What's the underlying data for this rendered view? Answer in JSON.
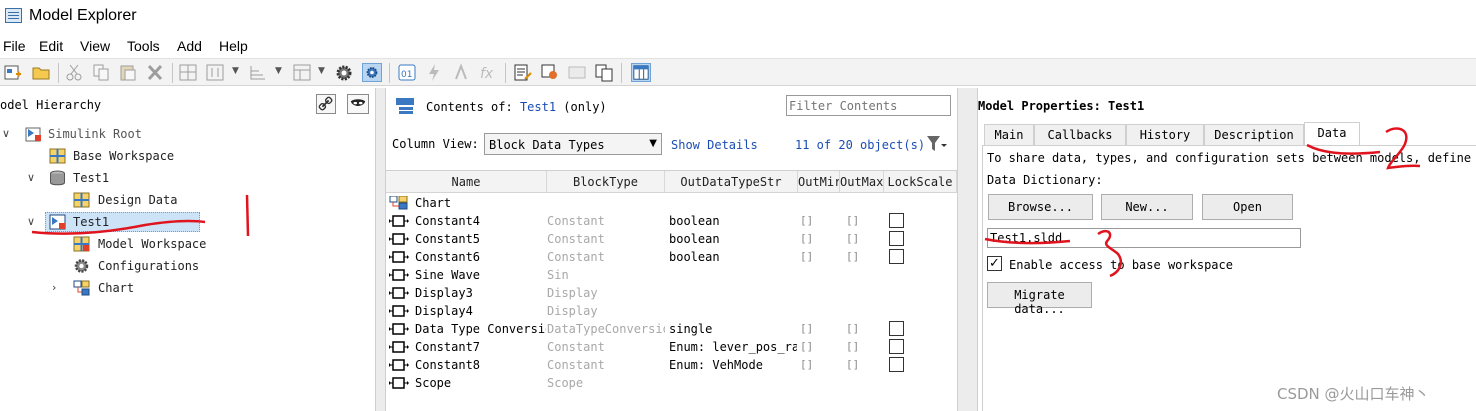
{
  "window": {
    "title": "Model Explorer"
  },
  "menu": [
    "File",
    "Edit",
    "View",
    "Tools",
    "Add",
    "Help"
  ],
  "hierarchy": {
    "title": "Model Hierarchy",
    "display_title": "odel Hierarchy",
    "nodes": [
      {
        "label": "Simulink Root",
        "level": 0,
        "expanded": true,
        "icon": "simulink-root-icon"
      },
      {
        "label": "Base Workspace",
        "level": 1,
        "icon": "workspace-icon"
      },
      {
        "label": "Test1",
        "level": 1,
        "expanded": true,
        "icon": "data-dictionary-icon"
      },
      {
        "label": "Design Data",
        "level": 2,
        "icon": "workspace-icon"
      },
      {
        "label": "Test1",
        "level": 1,
        "expanded": true,
        "icon": "model-icon",
        "selected": true
      },
      {
        "label": "Model Workspace",
        "level": 2,
        "icon": "model-workspace-icon"
      },
      {
        "label": "Configurations",
        "level": 2,
        "icon": "gear-icon"
      },
      {
        "label": "Chart",
        "level": 2,
        "expanded": false,
        "icon": "chart-icon"
      }
    ]
  },
  "contents": {
    "title_prefix": "Contents of:",
    "model_link": "Test1",
    "suffix": "(only)",
    "filter_placeholder": "Filter Contents",
    "column_view_label": "Column View:",
    "column_view_value": "Block Data Types",
    "show_details": "Show Details",
    "count": "11 of 20 object(s)",
    "columns": [
      "Name",
      "BlockType",
      "OutDataTypeStr",
      "OutMin",
      "OutMax",
      "LockScale"
    ],
    "columns_visible": [
      "Name",
      "BlockType",
      "OutDataTypeStr",
      "OutMir",
      "OutMax",
      "LockScale"
    ],
    "rows": [
      {
        "name": "Chart",
        "type": "",
        "dtype": "",
        "outmin": false,
        "outmax": false,
        "lock": false,
        "icon": "chart-icon"
      },
      {
        "name": "Constant4",
        "type": "Constant",
        "dtype": "boolean",
        "outmin": true,
        "outmax": true,
        "lock": true
      },
      {
        "name": "Constant5",
        "type": "Constant",
        "dtype": "boolean",
        "outmin": true,
        "outmax": true,
        "lock": true
      },
      {
        "name": "Constant6",
        "type": "Constant",
        "dtype": "boolean",
        "outmin": true,
        "outmax": true,
        "lock": true
      },
      {
        "name": "Sine Wave",
        "type": "Sin",
        "dtype": "",
        "outmin": false,
        "outmax": false,
        "lock": false
      },
      {
        "name": "Display3",
        "type": "Display",
        "dtype": "",
        "outmin": false,
        "outmax": false,
        "lock": false
      },
      {
        "name": "Display4",
        "type": "Display",
        "dtype": "",
        "outmin": false,
        "outmax": false,
        "lock": false
      },
      {
        "name": "Data Type Conversion",
        "type": "DataTypeConversion",
        "dtype": "single",
        "outmin": true,
        "outmax": true,
        "lock": true
      },
      {
        "name": "Constant7",
        "type": "Constant",
        "dtype": "Enum: lever_pos_raw",
        "outmin": true,
        "outmax": true,
        "lock": true
      },
      {
        "name": "Constant8",
        "type": "Constant",
        "dtype": "Enum: VehMode",
        "outmin": true,
        "outmax": true,
        "lock": true
      },
      {
        "name": "Scope",
        "type": "Scope",
        "dtype": "",
        "outmin": false,
        "outmax": false,
        "lock": false
      }
    ]
  },
  "properties": {
    "title": "Model Properties: Test1",
    "tabs": [
      "Main",
      "Callbacks",
      "History",
      "Description",
      "Data"
    ],
    "active_tab": "Data",
    "description": "To share data, types, and configuration sets between models, define them ou",
    "dd_label": "Data Dictionary:",
    "buttons": [
      "Browse...",
      "New...",
      "Open"
    ],
    "dd_value": "Test1.sldd",
    "checkbox_label": "Enable access to base workspace",
    "checkbox_checked": true,
    "migrate_label": "Migrate data..."
  },
  "annotations": {
    "numbers": [
      "1",
      "2",
      "3"
    ],
    "color": "#e0141e"
  },
  "watermark": "CSDN @火山口车神丶",
  "colors": {
    "link": "#1a4db3",
    "selection": "#cde3f7",
    "header": "#f3f3f3"
  }
}
